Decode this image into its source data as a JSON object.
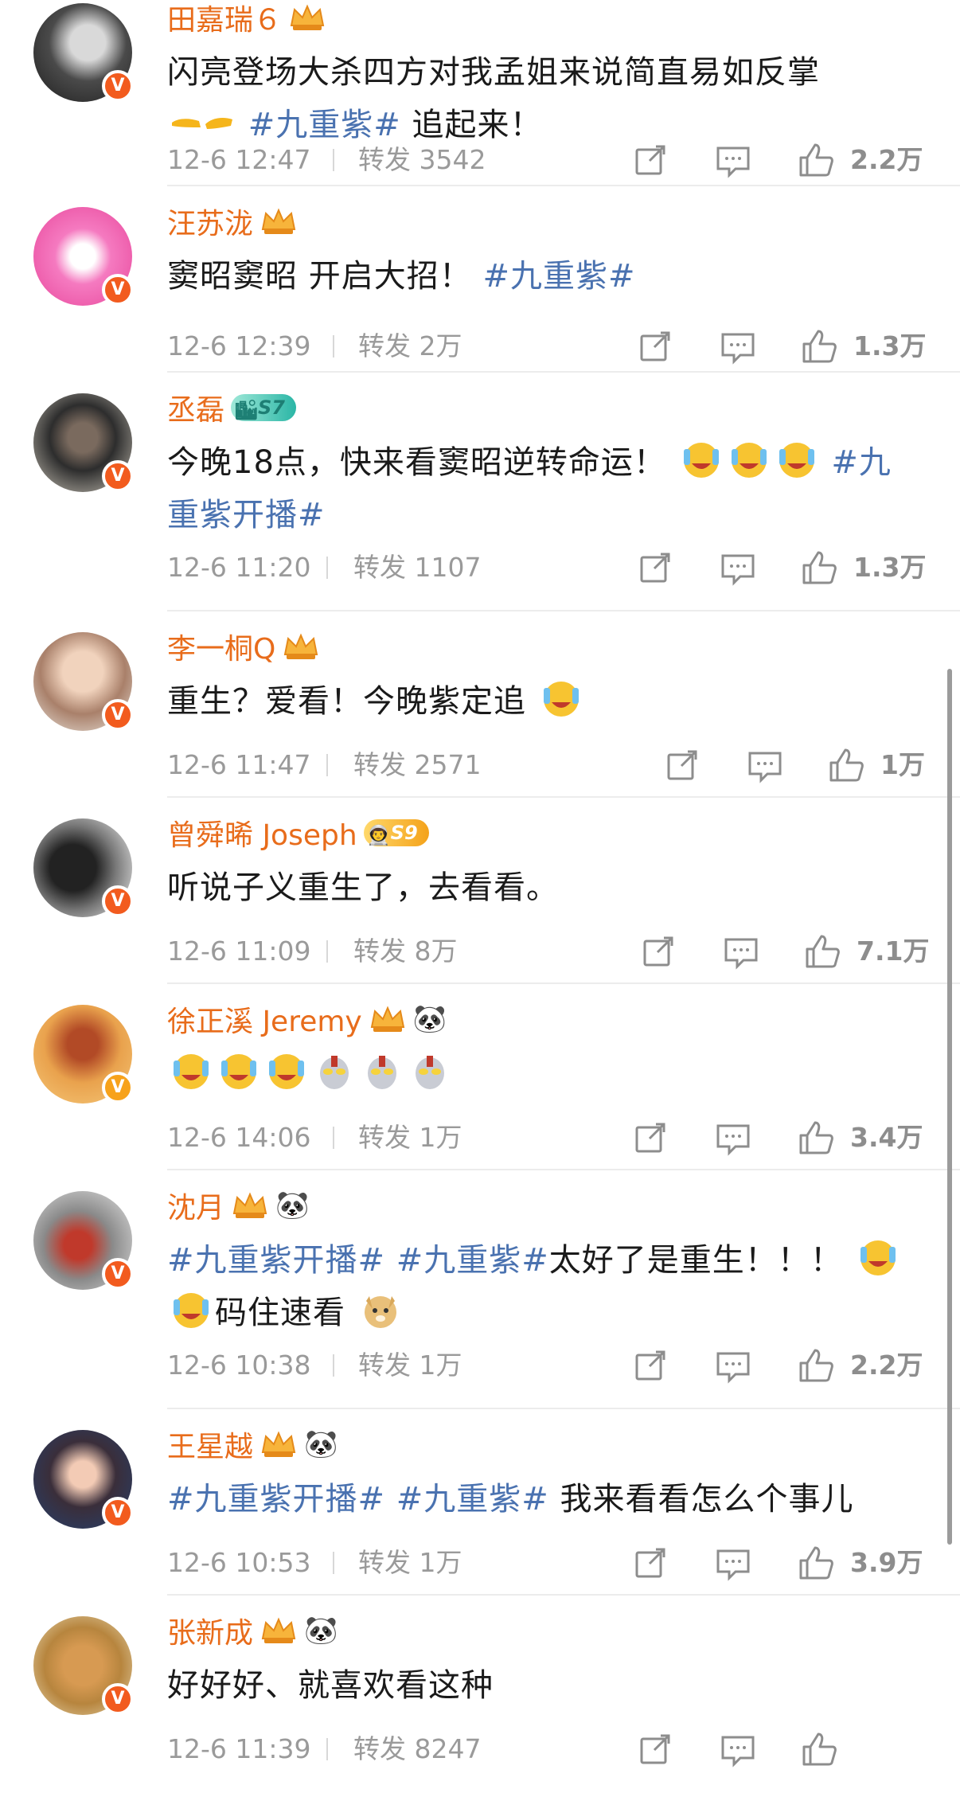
{
  "labels": {
    "repost": "转发"
  },
  "comments": [
    {
      "user": "田嘉瑞６",
      "text_parts": [
        "闪亮登场大杀四方对我孟姐来说简直易如反掌",
        "#九重紫#",
        "追起来！"
      ],
      "time": "12-6 12:47",
      "reposts": "3542",
      "likes": "2.2万"
    },
    {
      "user": "汪苏泷",
      "text_parts": [
        "窦昭窦昭 开启大招！",
        "#九重紫#"
      ],
      "time": "12-6 12:39",
      "reposts": "2万",
      "likes": "1.3万"
    },
    {
      "user": "丞磊",
      "level": "S7",
      "text_parts": [
        "今晚18点，快来看窦昭逆转命运！",
        "#九重紫开播#"
      ],
      "time": "12-6 11:20",
      "reposts": "1107",
      "likes": "1.3万"
    },
    {
      "user": "李一桐Q",
      "text_parts": [
        "重生？爱看！今晚紫定追"
      ],
      "time": "12-6 11:47",
      "reposts": "2571",
      "likes": "1万"
    },
    {
      "user": "曾舜晞 Joseph",
      "level": "S9",
      "text_parts": [
        "听说子义重生了，去看看。"
      ],
      "time": "12-6 11:09",
      "reposts": "8万",
      "likes": "7.1万"
    },
    {
      "user": "徐正溪 Jeremy",
      "text_parts": [],
      "time": "12-6 14:06",
      "reposts": "1万",
      "likes": "3.4万"
    },
    {
      "user": "沈月",
      "text_parts": [
        "#九重紫开播#",
        "#九重紫#",
        "太好了是重生！！！",
        "码住速看"
      ],
      "time": "12-6 10:38",
      "reposts": "1万",
      "likes": "2.2万"
    },
    {
      "user": "王星越",
      "text_parts": [
        "#九重紫开播#",
        "#九重紫#",
        "我来看看怎么个事儿"
      ],
      "time": "12-6 10:53",
      "reposts": "1万",
      "likes": "3.9万"
    },
    {
      "user": "张新成",
      "text_parts": [
        "好好好、就喜欢看这种"
      ],
      "time": "12-6 11:39",
      "reposts": "8247",
      "likes": ""
    }
  ],
  "colors": {
    "username": "#e86c1b",
    "hashtag": "#4a72b0",
    "meta": "#9a9a9a",
    "verified": "#f25b1e"
  }
}
